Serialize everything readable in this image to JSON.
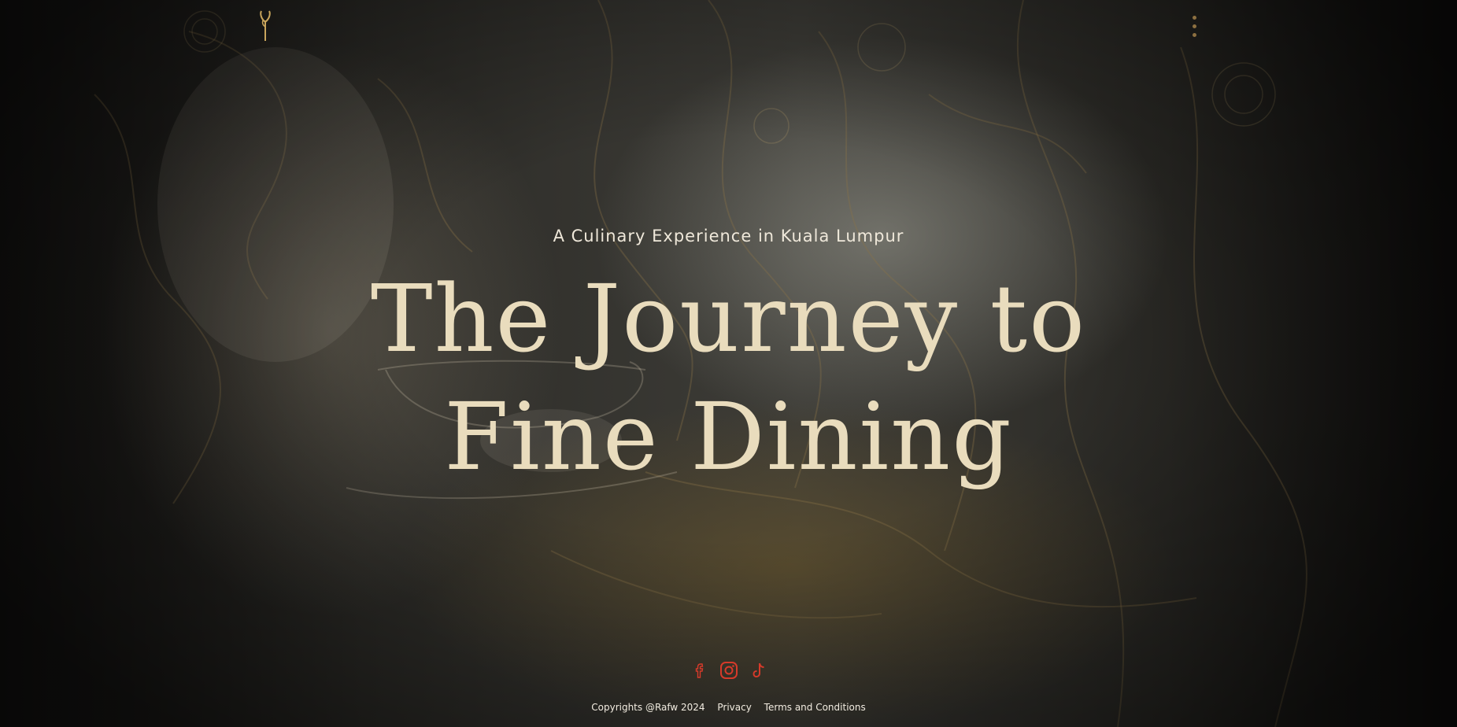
{
  "hero": {
    "subtitle": "A Culinary Experience in Kuala Lumpur",
    "headline_line1": "The Journey to",
    "headline_line2": "Fine Dining"
  },
  "header": {
    "logo_icon": "sprout-logo-icon",
    "menu_icon": "vertical-dots-menu-icon"
  },
  "social": [
    {
      "icon": "facebook-icon"
    },
    {
      "icon": "instagram-icon"
    },
    {
      "icon": "tiktok-icon"
    }
  ],
  "footer": {
    "copyright": "Copyrights @Rafw 2024",
    "privacy": "Privacy",
    "terms": "Terms and Conditions"
  },
  "colors": {
    "accent": "#e8dcba",
    "social_icon": "#d63a2a",
    "menu_dots": "#8d7040",
    "logo": "#c9a55c"
  }
}
